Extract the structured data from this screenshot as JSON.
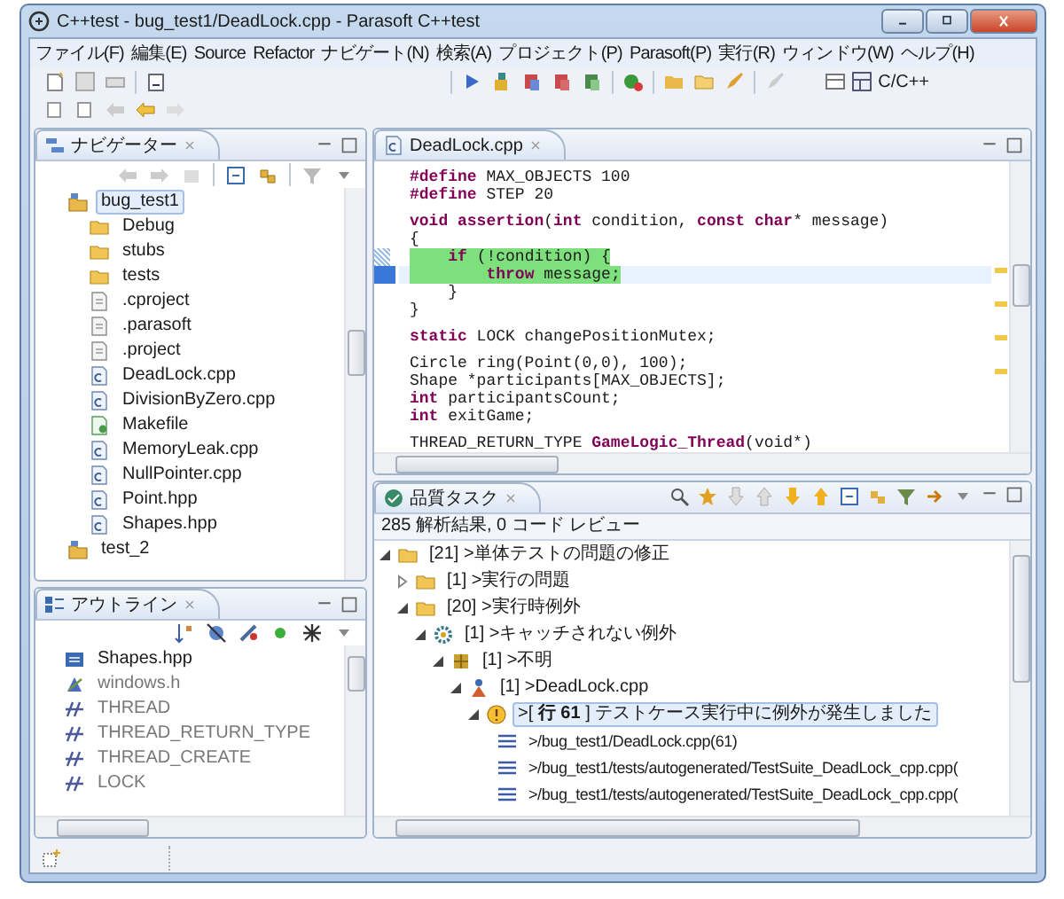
{
  "window": {
    "title": "C++test - bug_test1/DeadLock.cpp - Parasoft C++test"
  },
  "menu": [
    "ファイル(F)",
    "編集(E)",
    "Source",
    "Refactor",
    "ナビゲート(N)",
    "検索(A)",
    "プロジェクト(P)",
    "Parasoft(P)",
    "実行(R)",
    "ウィンドウ(W)",
    "ヘルプ(H)"
  ],
  "perspective": {
    "label": "C/C++"
  },
  "navigator": {
    "title": "ナビゲーター",
    "tree": [
      {
        "label": "bug_test1",
        "kind": "project",
        "selected": true,
        "children": [
          {
            "label": "Debug",
            "kind": "folder",
            "selected": false
          },
          {
            "label": "stubs",
            "kind": "folder",
            "selected": false
          },
          {
            "label": "tests",
            "kind": "folder",
            "selected": false
          },
          {
            "label": ".cproject",
            "kind": "file",
            "selected": false
          },
          {
            "label": ".parasoft",
            "kind": "file",
            "selected": false
          },
          {
            "label": ".project",
            "kind": "file",
            "selected": false
          },
          {
            "label": "DeadLock.cpp",
            "kind": "source",
            "selected": false
          },
          {
            "label": "DivisionByZero.cpp",
            "kind": "source",
            "selected": false
          },
          {
            "label": "Makefile",
            "kind": "makefile",
            "selected": false
          },
          {
            "label": "MemoryLeak.cpp",
            "kind": "source",
            "selected": false
          },
          {
            "label": "NullPointer.cpp",
            "kind": "source",
            "selected": false
          },
          {
            "label": "Point.hpp",
            "kind": "source",
            "selected": false
          },
          {
            "label": "Shapes.hpp",
            "kind": "source",
            "selected": false
          }
        ]
      },
      {
        "label": "test_2",
        "kind": "project",
        "selected": false
      }
    ]
  },
  "outline": {
    "title": "アウトライン",
    "items": [
      {
        "label": "Shapes.hpp",
        "kind": "header"
      },
      {
        "label": "windows.h",
        "kind": "include"
      },
      {
        "label": "THREAD",
        "kind": "macro"
      },
      {
        "label": "THREAD_RETURN_TYPE",
        "kind": "macro"
      },
      {
        "label": "THREAD_CREATE",
        "kind": "macro"
      },
      {
        "label": "LOCK",
        "kind": "macro"
      }
    ]
  },
  "editor": {
    "tab": "DeadLock.cpp",
    "blocks": [
      {
        "lines": [
          {
            "text": "**#define** MAX_OBJECTS 100",
            "covered": false,
            "current": false
          },
          {
            "text": "**#define** STEP 20",
            "covered": false,
            "current": false
          }
        ]
      },
      {
        "lines": [
          {
            "text": "**void assertion**(**int** condition, **const char*** message)",
            "covered": false,
            "current": false
          },
          {
            "text": "{",
            "covered": false,
            "current": false
          },
          {
            "text": "    **if** (!condition) {",
            "covered": true,
            "current": false
          },
          {
            "text": "        **throw** message;",
            "covered": true,
            "current": true
          },
          {
            "text": "    }",
            "covered": false,
            "current": false
          },
          {
            "text": "}",
            "covered": false,
            "current": false
          }
        ]
      },
      {
        "lines": [
          {
            "text": "**static** LOCK changePositionMutex;",
            "covered": false,
            "current": false
          }
        ]
      },
      {
        "lines": [
          {
            "text": "Circle ring(Point(0,0), 100);",
            "covered": false,
            "current": false
          },
          {
            "text": "Shape *participants[MAX_OBJECTS];",
            "covered": false,
            "current": false
          },
          {
            "text": "**int** participantsCount;",
            "covered": false,
            "current": false
          },
          {
            "text": "**int** exitGame;",
            "covered": false,
            "current": false
          }
        ]
      },
      {
        "lines": [
          {
            "text": "THREAD_RETURN_TYPE **GameLogic_Thread**(void*)",
            "covered": false,
            "current": false
          }
        ]
      }
    ]
  },
  "tasks": {
    "title": "品質タスク",
    "summary": "285 解析結果, 0 コード レビュー",
    "tree": [
      {
        "label": "[21] >単体テストの問題の修正",
        "kind": "category",
        "expanded": true,
        "selected": false,
        "children": [
          {
            "label": "[1] >実行の問題",
            "kind": "category",
            "expanded": false,
            "selected": false
          },
          {
            "label": "[20] >実行時例外",
            "kind": "category",
            "expanded": true,
            "selected": false,
            "children": [
              {
                "label": "[1] >キャッチされない例外",
                "kind": "rule",
                "expanded": true,
                "selected": false,
                "children": [
                  {
                    "label": "[1] >不明",
                    "kind": "author",
                    "expanded": true,
                    "selected": false,
                    "children": [
                      {
                        "label": "[1] >DeadLock.cpp",
                        "kind": "file",
                        "expanded": true,
                        "selected": false,
                        "children": [
                          {
                            "label": ">[ **行 61** ] テストケース実行中に例外が発生しました",
                            "kind": "warning",
                            "expanded": true,
                            "selected": true,
                            "children": [
                              {
                                "label": ">/bug_test1/DeadLock.cpp(61)",
                                "kind": "location",
                                "selected": false
                              },
                              {
                                "label": ">/bug_test1/tests/autogenerated/TestSuite_DeadLock_cpp.cpp(",
                                "kind": "location",
                                "selected": false
                              },
                              {
                                "label": ">/bug_test1/tests/autogenerated/TestSuite_DeadLock_cpp.cpp(",
                                "kind": "location",
                                "selected": false
                              }
                            ]
                          }
                        ]
                      }
                    ]
                  }
                ]
              }
            ]
          }
        ]
      }
    ]
  }
}
